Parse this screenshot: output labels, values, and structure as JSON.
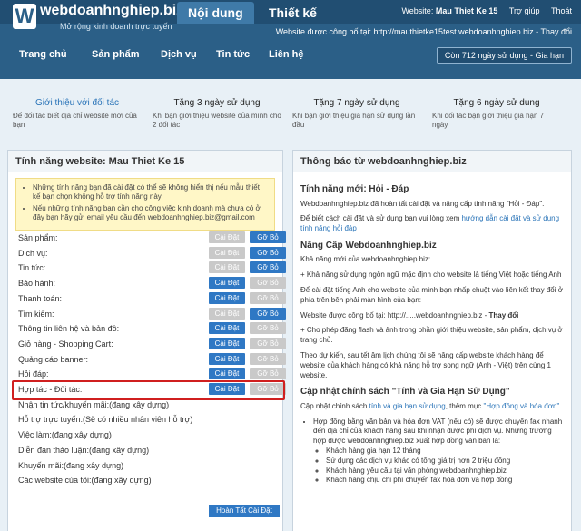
{
  "header": {
    "logo_letter": "W",
    "brand": "webdoanhnghiep.biz",
    "slogan": "Mở rộng kinh doanh trực tuyến",
    "tabs": [
      {
        "label": "Nội dung"
      },
      {
        "label": "Thiết kế"
      }
    ],
    "website_label": "Website:",
    "website_name": "Mau Thiet Ke 15",
    "help": "Trợ giúp",
    "logout": "Thoát",
    "pub_text": "Website được công bố tại: http://mauthietke15test.webdoanhnghiep.biz - Thay đổi",
    "nav": [
      "Trang chủ",
      "Sản phẩm",
      "Dịch vụ",
      "Tin tức",
      "Liên hệ"
    ],
    "days_left": "Còn 712 ngày sử dụng - Gia hạn"
  },
  "intro": [
    {
      "title": "Giới thiệu với đối tác",
      "desc": "Để đối tác biết địa chỉ website mới của bạn"
    },
    {
      "title": "Tặng 3 ngày sử dụng",
      "desc": "Khi bạn giới thiệu website của mình cho 2 đối tác"
    },
    {
      "title": "Tặng 7 ngày sử dụng",
      "desc": "Khi bạn giới thiệu gia hạn sử dụng lần đầu"
    },
    {
      "title": "Tặng 6 ngày sử dụng",
      "desc": "Khi đối tác bạn giới thiệu gia hạn 7 ngày"
    }
  ],
  "left": {
    "title": "Tính năng website: Mau Thiet Ke 15",
    "notes": [
      "Những tính năng bạn đã cài đặt có thể sẽ không hiển thị nếu mẫu thiết kế bạn chọn không hỗ trợ tính năng này.",
      "Nếu những tính năng bạn cần cho công việc kinh doanh mà chưa có ở đây bạn hãy gửi email yêu cầu đến webdoanhnghiep.biz@gmail.com"
    ],
    "install_label": "Cài Đặt",
    "remove_label": "Gỡ Bỏ",
    "features": [
      {
        "label": "Sản phẩm:",
        "installed": true
      },
      {
        "label": "Dịch vụ:",
        "installed": true
      },
      {
        "label": "Tin tức:",
        "installed": true
      },
      {
        "label": "Bảo hành:",
        "installed": false
      },
      {
        "label": "Thanh toán:",
        "installed": false
      },
      {
        "label": "Tìm kiếm:",
        "installed": true
      },
      {
        "label": "Thông tin liên hệ và bản đồ:",
        "installed": false
      },
      {
        "label": "Giỏ hàng - Shopping Cart:",
        "installed": false
      },
      {
        "label": "Quảng cáo banner:",
        "installed": false
      },
      {
        "label": "Hỏi đáp:",
        "installed": false
      },
      {
        "label": "Hợp tác - Đối tác:",
        "installed": false
      },
      {
        "label": "Nhận tin tức/khuyến mãi:(đang xây dựng)",
        "installed": null
      },
      {
        "label": "Hỗ trợ trực tuyến:(Sẽ có nhiều nhân viên hỗ trợ)",
        "installed": null
      },
      {
        "label": "Việc làm:(đang xây dựng)",
        "installed": null
      },
      {
        "label": "Diễn đàn thảo luận:(đang xây dựng)",
        "installed": null
      },
      {
        "label": "Khuyến mãi:(đang xây dựng)",
        "installed": null
      },
      {
        "label": "Các website của tôi:(đang xây dựng)",
        "installed": null
      }
    ],
    "finish_button": "Hoàn Tất Cài Đặt"
  },
  "right": {
    "title": "Thông báo từ webdoanhnghiep.biz",
    "s1_title": "Tính năng mới: Hỏi - Đáp",
    "s1_p1": "Webdoanhnghiep.biz đã hoàn tất cài đặt và nâng cấp tính năng \"Hỏi - Đáp\".",
    "s1_p2a": "Để biết cách cài đặt và sử dụng bạn vui lòng xem ",
    "s1_p2link": "hướng dẫn cài đặt và sử dụng tính năng hỏi đáp",
    "s2_title": "Nâng Cấp Webdoanhnghiep.biz",
    "s2_p1": "Khả năng mới của webdoanhnghiep.biz:",
    "s2_p2": "+ Khả năng sử dụng ngôn ngữ mặc định cho website là tiếng Việt hoặc tiếng Anh",
    "s2_p3": "Để cài đặt tiếng Anh cho website của mình bạn nhấp chuột vào liên kết thay đổi ở phía trên bên phải màn hình của bạn:",
    "s2_p4a": "Website được công bố tại: http://.....webdoanhnghiep.biz - ",
    "s2_p4b": "Thay đổi",
    "s2_p5": "+ Cho phép đăng flash và ảnh trong phần giới thiệu website, sản phẩm, dịch vụ ở trang chủ.",
    "s2_p6": "Theo dự kiến, sau tết âm lịch chúng tôi sẽ nâng cấp website khách hàng để website của khách hàng có khả năng hỗ trợ song ngữ (Anh - Việt) trên cùng 1 website.",
    "s3_title": "Cập nhật chính sách \"Tính và Gia Hạn Sử Dụng\"",
    "s3_p1a": "Cập nhật chính sách ",
    "s3_p1link1": "tính và gia hạn sử dụng",
    "s3_p1b": ", thêm mục ",
    "s3_p1link2": "\"Hợp đồng và hóa đơn\"",
    "s3_item": "Hợp đồng bằng văn bản và hóa đơn VAT (nếu có) sẽ được chuyển fax nhanh đến địa chỉ của khách hàng sau khi nhận được phí dịch vụ. Những trường hợp được webdoanhnghiep.biz xuất hợp đồng văn bản là:",
    "s3_sub": [
      "Khách hàng gia hạn 12 tháng",
      "Sử dụng các dịch vụ khác có tổng giá trị hơn 2 triệu đồng",
      "Khách hàng yêu cầu tại văn phòng webdoanhnghiep.biz",
      "Khách hàng chịu chi phí chuyển fax hóa đơn và hợp đồng"
    ]
  }
}
